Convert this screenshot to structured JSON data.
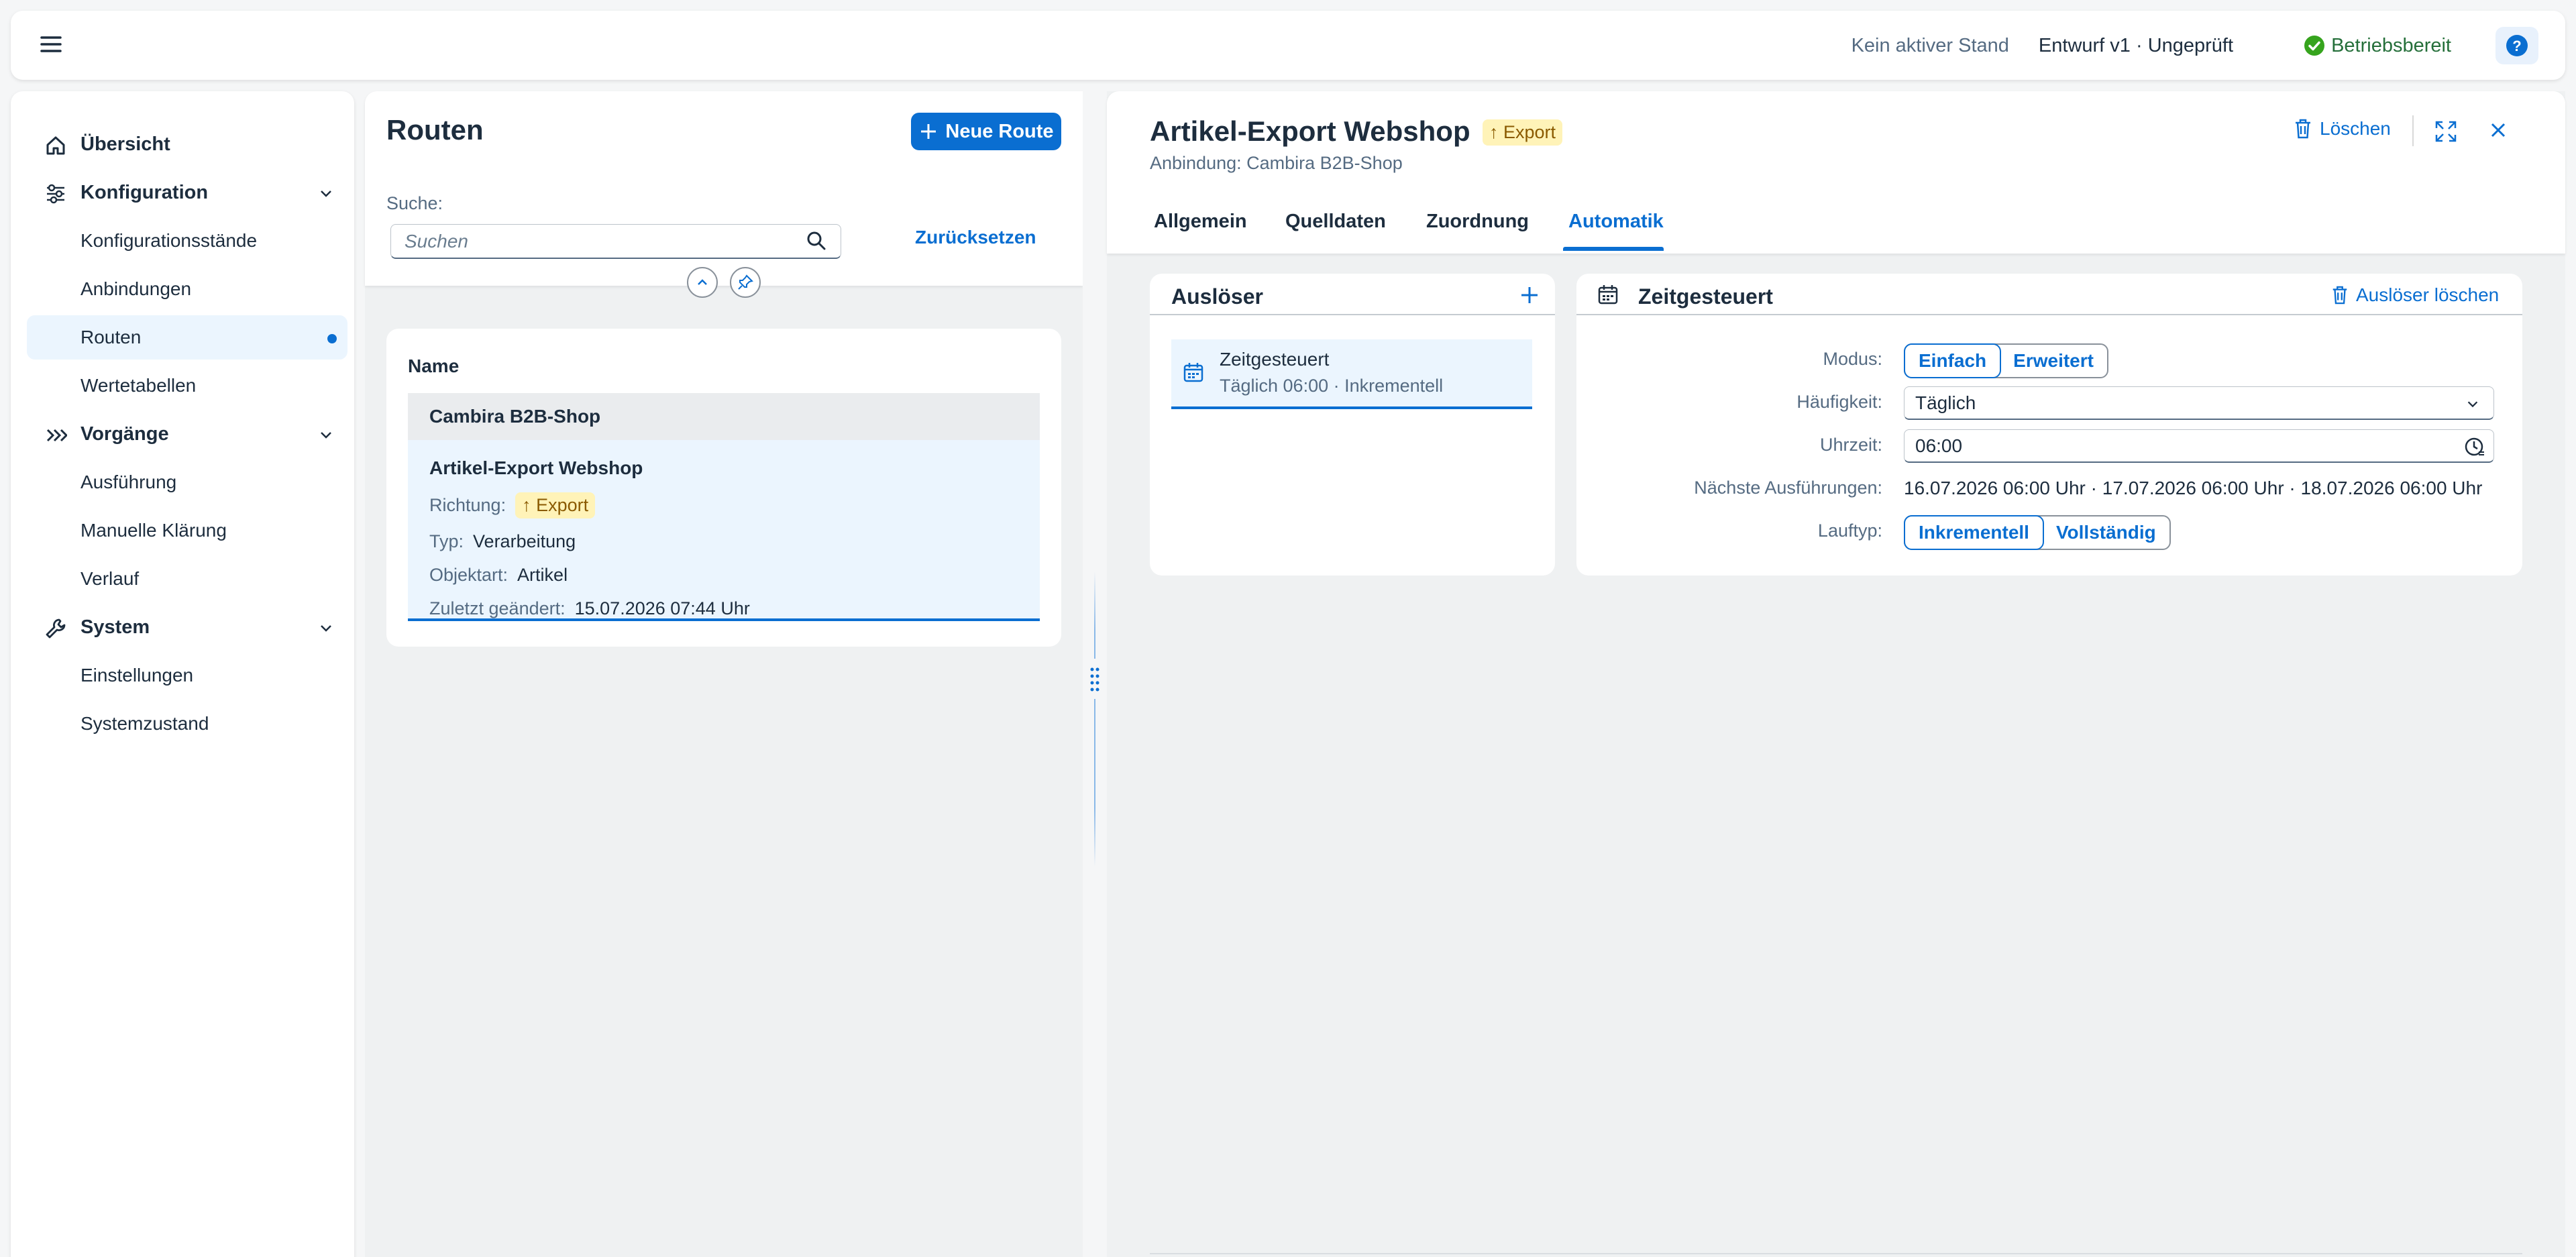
{
  "shell": {
    "stand": "Kein aktiver Stand",
    "draft": "Entwurf v1 · Ungeprüft",
    "status": "Betriebsbereit",
    "help": "?"
  },
  "nav": {
    "overview": "Übersicht",
    "config": "Konfiguration",
    "config_items": [
      "Konfigurationsstände",
      "Anbindungen",
      "Routen",
      "Wertetabellen"
    ],
    "processes": "Vorgänge",
    "process_items": [
      "Ausführung",
      "Manuelle Klärung",
      "Verlauf"
    ],
    "system": "System",
    "system_items": [
      "Einstellungen",
      "Systemzustand"
    ]
  },
  "routes": {
    "title": "Routen",
    "new_button": "Neue Route",
    "search_label": "Suche:",
    "search_placeholder": "Suchen",
    "reset": "Zurücksetzen",
    "column_name": "Name",
    "group": "Cambira B2B-Shop",
    "item": {
      "title": "Artikel-Export Webshop",
      "direction_label": "Richtung:",
      "direction": "↑ Export",
      "type_label": "Typ:",
      "type": "Verarbeitung",
      "object_label": "Objektart:",
      "object": "Artikel",
      "changed_label": "Zuletzt geändert:",
      "changed": "15.07.2026 07:44 Uhr"
    }
  },
  "detail": {
    "title": "Artikel-Export Webshop",
    "badge": "↑ Export",
    "subtitle": "Anbindung: Cambira B2B-Shop",
    "delete": "Löschen",
    "tabs": [
      "Allgemein",
      "Quelldaten",
      "Zuordnung",
      "Automatik"
    ],
    "active_tab": "Automatik",
    "triggers": {
      "title": "Auslöser",
      "item_title": "Zeitgesteuert",
      "item_sub": "Täglich 06:00 · Inkrementell"
    },
    "schedule": {
      "title": "Zeitgesteuert",
      "delete_trigger": "Auslöser löschen",
      "mode_label": "Modus:",
      "mode_options": [
        "Einfach",
        "Erweitert"
      ],
      "frequency_label": "Häufigkeit:",
      "frequency": "Täglich",
      "time_label": "Uhrzeit:",
      "time": "06:00",
      "next_label": "Nächste Ausführungen:",
      "next_runs": "16.07.2026 06:00 Uhr · 17.07.2026 06:00 Uhr · 18.07.2026 06:00 Uhr",
      "runtype_label": "Lauftyp:",
      "runtype_options": [
        "Inkrementell",
        "Vollständig"
      ]
    }
  }
}
